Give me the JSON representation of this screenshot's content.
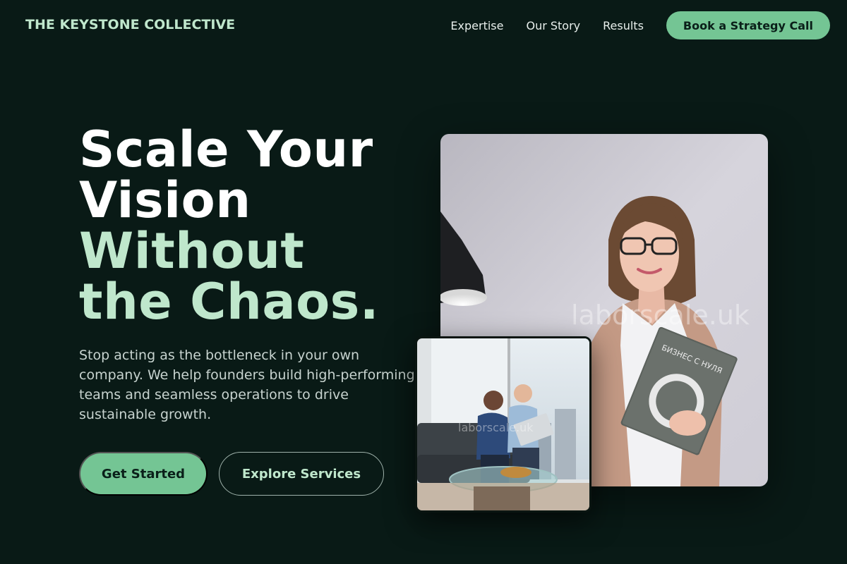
{
  "header": {
    "brand": "THE KEYSTONE COLLECTIVE",
    "nav": [
      "Expertise",
      "Our Story",
      "Results"
    ],
    "cta_label": "Book a Strategy Call"
  },
  "hero": {
    "headline_white": [
      "Scale Your",
      "Vision"
    ],
    "headline_green": [
      "Without",
      "the Chaos."
    ],
    "lede": "Stop acting as the bottleneck in your own company. We help founders build high-performing teams and seamless operations to drive sustainable growth.",
    "primary_label": "Get Started",
    "secondary_label": "Explore Services"
  },
  "images": {
    "main_watermark": "laborscale.uk",
    "small_watermark": "laborscale.uk",
    "book_title": "БИЗНЕС С НУЛЯ"
  },
  "colors": {
    "background": "#091a16",
    "accent": "#74c594",
    "accent_light": "#bfe7cc"
  }
}
